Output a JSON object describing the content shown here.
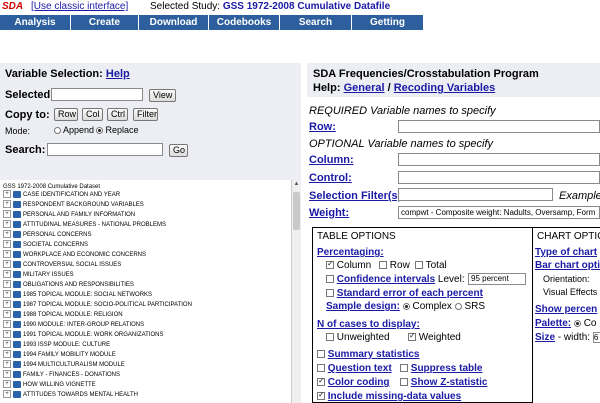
{
  "topbar": {
    "sda_label": "SDA",
    "classic_link": "[Use classic interface]",
    "study_label": "Selected Study:",
    "study_name": "GSS 1972-2008 Cumulative Datafile"
  },
  "nav": [
    "Analysis",
    "Create Variables",
    "Download",
    "Codebooks",
    "Search",
    "Getting Started"
  ],
  "left": {
    "title": "Variable Selection:",
    "help": "Help",
    "selected_label": "Selected:",
    "view_button": "View",
    "copy_to_label": "Copy to:",
    "copy_buttons": [
      "Row",
      "Col",
      "Ctrl",
      "Filter"
    ],
    "mode_label": "Mode:",
    "mode_options": [
      "Append",
      "Replace"
    ],
    "mode_selected": "Replace",
    "search_label": "Search:",
    "go_button": "Go",
    "tree_root": "GSS 1972-2008 Cumulative Dataset",
    "tree_items": [
      "CASE IDENTIFICATION AND YEAR",
      "RESPONDENT BACKGROUND VARIABLES",
      "PERSONAL AND FAMILY INFORMATION",
      "ATTITUDINAL MEASURES - NATIONAL PROBLEMS",
      "PERSONAL CONCERNS",
      "SOCIETAL CONCERNS",
      "WORKPLACE AND ECONOMIC CONCERNS",
      "CONTROVERSIAL SOCIAL ISSUES",
      "MILITARY ISSUES",
      "OBLIGATIONS AND RESPONSIBILITIES",
      "1985 TOPICAL MODULE: SOCIAL NETWORKS",
      "1987 TOPICAL MODULE: SOCIO-POLITICAL PARTICIPATION",
      "1988 TOPICAL MODULE: RELIGION",
      "1990 MODULE: INTER-GROUP RELATIONS",
      "1991 TOPICAL MODULE: WORK ORGANIZATIONS",
      "1993 ISSP MODULE: CULTURE",
      "1994 FAMILY MOBILITY MODULE",
      "1994 MULTICULTURALISM MODULE",
      "FAMILY - FINANCES - DONATIONS",
      "HOW WILLING VIGNETTE",
      "ATTITUDES TOWARDS MENTAL HEALTH"
    ]
  },
  "right": {
    "title": "SDA Frequencies/Crosstabulation Program",
    "help_label": "Help:",
    "help_general": "General",
    "help_sep": "/",
    "help_recoding": "Recoding Variables",
    "required_text": "REQUIRED Variable names to specify",
    "row_label": "Row:",
    "optional_text": "OPTIONAL Variable names to specify",
    "column_label": "Column:",
    "control_label": "Control:",
    "filter_label": "Selection Filter(s):",
    "filter_example": "Example",
    "weight_label": "Weight:",
    "weight_value": "compwt - Composite weight: Nadults, Oversamp, Form",
    "table_options": {
      "title": "TABLE OPTIONS",
      "percentaging": "Percentaging:",
      "pct_column": "Column",
      "pct_row": "Row",
      "pct_total": "Total",
      "confidence": "Confidence intervals",
      "level": "Level:",
      "level_value": "95 percent",
      "std_error": "Standard error of each percent",
      "sample_design": "Sample design:",
      "complex": "Complex",
      "srs": "SRS",
      "n_cases": "N of cases to display:",
      "unweighted": "Unweighted",
      "weighted": "Weighted",
      "summary": "Summary statistics",
      "question_text": "Question text",
      "suppress": "Suppress table",
      "color_coding": "Color coding",
      "show_z": "Show Z-statistic",
      "missing": "Include missing-data values"
    },
    "chart_options": {
      "title": "CHART OPTIO",
      "type_of_chart": "Type of chart",
      "bar_chart_opt": "Bar chart opti",
      "orientation": "Orientation:",
      "visual_effects": "Visual Effects",
      "show_percent": "Show percen",
      "palette": "Palette:",
      "palette_val": "Co",
      "size": "Size",
      "width": "- width:",
      "width_val": "6"
    }
  }
}
